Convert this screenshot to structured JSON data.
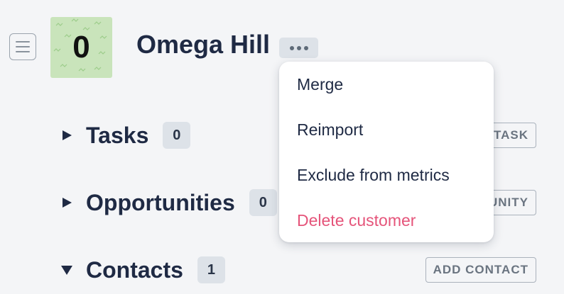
{
  "header": {
    "avatar_text": "0",
    "title": "Omega Hill"
  },
  "sections": [
    {
      "label": "Tasks",
      "count": "0",
      "expanded": false,
      "action": "TASK"
    },
    {
      "label": "Opportunities",
      "count": "0",
      "expanded": false,
      "action": "UNITY"
    },
    {
      "label": "Contacts",
      "count": "1",
      "expanded": true,
      "action": "ADD CONTACT"
    }
  ],
  "dropdown": {
    "items": [
      {
        "label": "Merge",
        "color": "#1f2a44"
      },
      {
        "label": "Reimport",
        "color": "#1f2a44"
      },
      {
        "label": "Exclude from metrics",
        "color": "#1f2a44"
      },
      {
        "label": "Delete customer",
        "color": "#e5547a"
      }
    ]
  },
  "colors": {
    "background": "#f4f5f7",
    "text": "#1f2a44",
    "avatar_bg": "#c9e4bb",
    "danger": "#e5547a"
  },
  "icons": {
    "menu_toggle": "hamburger-icon",
    "more": "ellipsis-icon",
    "collapsed": "caret-right-icon",
    "expanded": "caret-down-icon"
  }
}
